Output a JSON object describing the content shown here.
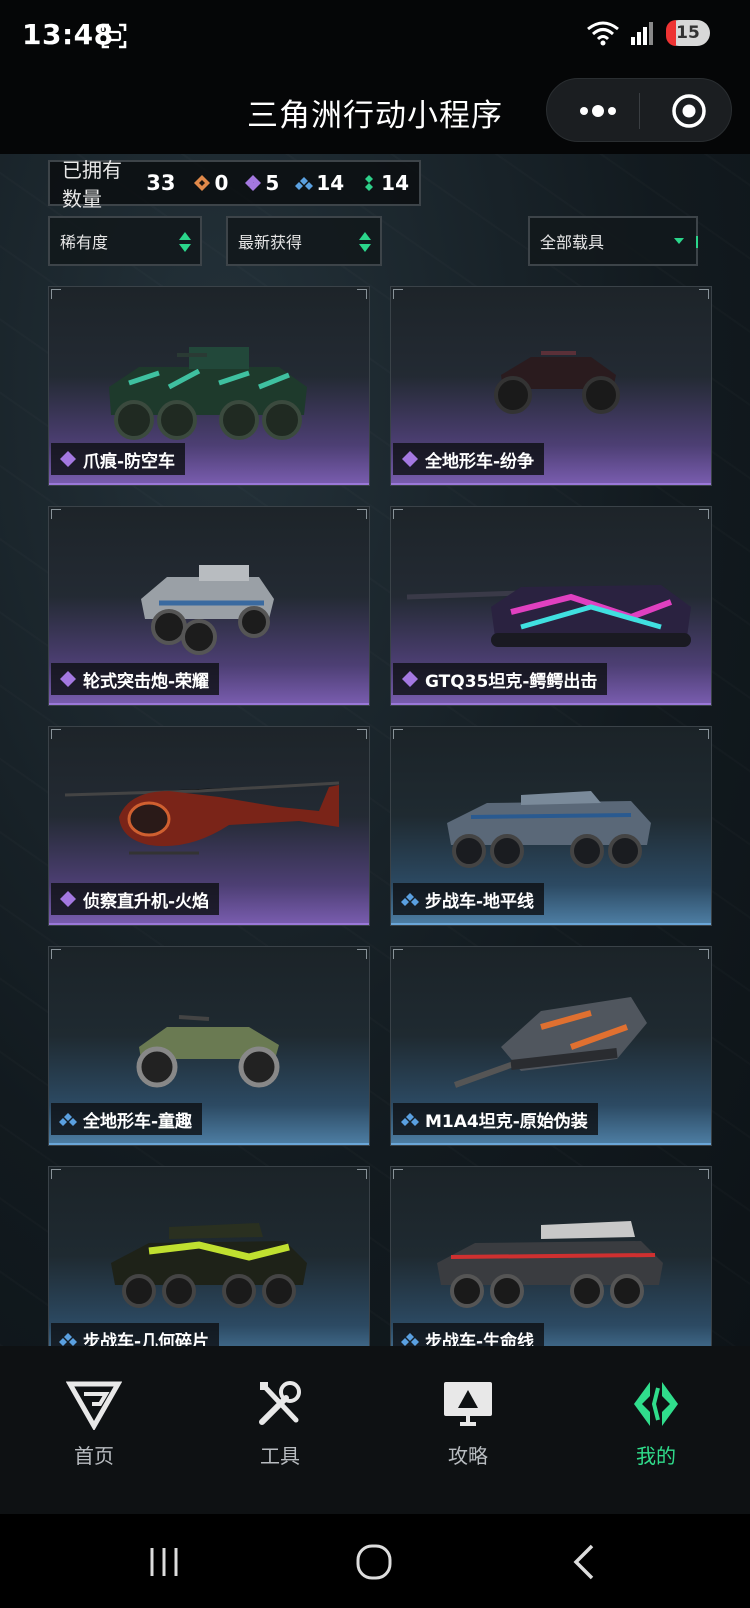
{
  "status_bar": {
    "time": "13:48",
    "battery": "15"
  },
  "header": {
    "title": "三角洲行动小程序"
  },
  "summary": {
    "owned_label": "已拥有数量",
    "owned_count": "33",
    "rarities": [
      {
        "name": "orange",
        "count": "0",
        "color": "#e0894a"
      },
      {
        "name": "purple",
        "count": "5",
        "color": "#a478e0"
      },
      {
        "name": "blue",
        "count": "14",
        "color": "#5aa0e0"
      },
      {
        "name": "green",
        "count": "14",
        "color": "#2ed08a"
      }
    ]
  },
  "filters": {
    "rarity": "稀有度",
    "sort": "最新获得",
    "vehicle_type": "全部载具"
  },
  "vehicles": [
    {
      "name": "爪痕-防空车",
      "rarity": "purple"
    },
    {
      "name": "全地形车-纷争",
      "rarity": "purple"
    },
    {
      "name": "轮式突击炮-荣耀",
      "rarity": "purple"
    },
    {
      "name": "GTQ35坦克-鳄鳄出击",
      "rarity": "purple"
    },
    {
      "name": "侦察直升机-火焰",
      "rarity": "purple"
    },
    {
      "name": "步战车-地平线",
      "rarity": "blue"
    },
    {
      "name": "全地形车-童趣",
      "rarity": "blue"
    },
    {
      "name": "M1A4坦克-原始伪装",
      "rarity": "blue"
    },
    {
      "name": "步战车-几何碎片",
      "rarity": "blue"
    },
    {
      "name": "步战车-生命线",
      "rarity": "blue"
    }
  ],
  "nav": {
    "home": "首页",
    "tools": "工具",
    "guide": "攻略",
    "mine": "我的"
  },
  "colors": {
    "accent": "#30dd8c",
    "purple": "#a478e0",
    "blue": "#5aa0e0"
  }
}
